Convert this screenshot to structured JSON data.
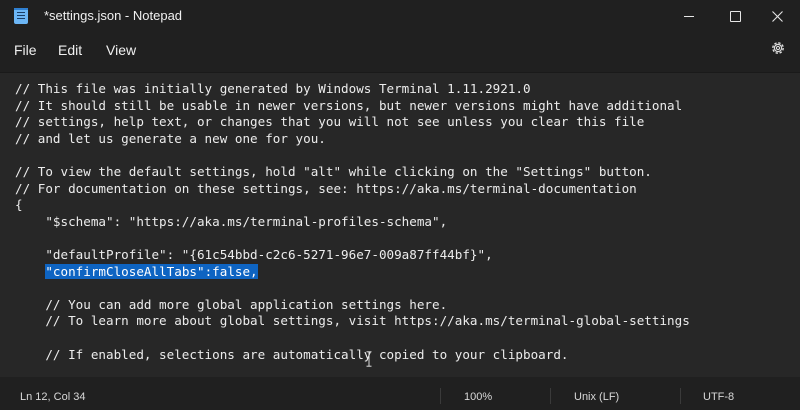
{
  "window": {
    "title": "*settings.json - Notepad"
  },
  "menu": {
    "file": "File",
    "edit": "Edit",
    "view": "View"
  },
  "icons": {
    "app": "notepad-icon",
    "settings": "gear-icon",
    "minimize": "minimize-icon",
    "maximize": "maximize-icon",
    "close": "close-icon"
  },
  "editor": {
    "lines": [
      "// This file was initially generated by Windows Terminal 1.11.2921.0",
      "// It should still be usable in newer versions, but newer versions might have additional",
      "// settings, help text, or changes that you will not see unless you clear this file",
      "// and let us generate a new one for you.",
      "",
      "// To view the default settings, hold \"alt\" while clicking on the \"Settings\" button.",
      "// For documentation on these settings, see: https://aka.ms/terminal-documentation",
      "{",
      "    \"$schema\": \"https://aka.ms/terminal-profiles-schema\",",
      "",
      "    \"defaultProfile\": \"{61c54bbd-c2c6-5271-96e7-009a87ff44bf}\",",
      "",
      "",
      "    // You can add more global application settings here.",
      "    // To learn more about global settings, visit https://aka.ms/terminal-global-settings",
      "",
      "    // If enabled, selections are automatically copied to your clipboard."
    ],
    "selected_line_indent": "    ",
    "selected_text": "\"confirmCloseAllTabs\":false,"
  },
  "status": {
    "position": "Ln 12, Col 34",
    "zoom": "100%",
    "line_ending": "Unix (LF)",
    "encoding": "UTF-8"
  },
  "colors": {
    "selection": "#0e64c2",
    "background": "#272727",
    "chrome": "#202020"
  }
}
